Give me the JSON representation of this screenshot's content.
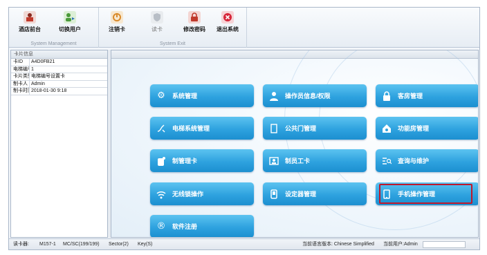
{
  "ribbon": {
    "groups": [
      {
        "caption": "System Management",
        "buttons": [
          {
            "label": "酒店前台",
            "icon": "front-desk-icon",
            "color": "#c0392b"
          },
          {
            "label": "切换用户",
            "icon": "switch-user-icon",
            "color": "#4a9a3a"
          }
        ]
      },
      {
        "caption": "System Exit",
        "buttons": [
          {
            "label": "注销卡",
            "icon": "cancel-card-icon",
            "color": "#d98a2b"
          },
          {
            "label": "读卡",
            "icon": "read-card-icon",
            "color": "#b8bec6",
            "disabled": true
          },
          {
            "label": "修改密码",
            "icon": "lock-icon",
            "color": "#c0392b"
          },
          {
            "label": "退出系统",
            "icon": "exit-icon",
            "color": "#d6263a"
          }
        ]
      }
    ]
  },
  "card_panel": {
    "title": "卡片信息",
    "rows": [
      {
        "key": "卡ID",
        "value": "A4D0FB21"
      },
      {
        "key": "电梯编号",
        "value": "1"
      },
      {
        "key": "卡片类型",
        "value": "电梯编号设置卡"
      },
      {
        "key": "制卡人",
        "value": "Admin"
      },
      {
        "key": "制卡时间",
        "value": "2018-01-30 9:18"
      }
    ]
  },
  "tiles": [
    {
      "label": "系统管理",
      "icon": "gear-icon"
    },
    {
      "label": "操作员信息/权限",
      "icon": "user-icon"
    },
    {
      "label": "客房管理",
      "icon": "lock-icon"
    },
    {
      "label": "电梯系统管理",
      "icon": "elevator-icon"
    },
    {
      "label": "公共门管理",
      "icon": "door-icon"
    },
    {
      "label": "功能房管理",
      "icon": "function-room-icon"
    },
    {
      "label": "制管理卡",
      "icon": "card-icon"
    },
    {
      "label": "制员工卡",
      "icon": "id-card-icon"
    },
    {
      "label": "查询与维护",
      "icon": "search-list-icon"
    },
    {
      "label": "无线锁操作",
      "icon": "wireless-icon"
    },
    {
      "label": "设定器管理",
      "icon": "device-icon"
    },
    {
      "label": "手机操作管理",
      "icon": "mobile-icon",
      "selected": true
    },
    {
      "label": "软件注册",
      "icon": "registered-icon"
    }
  ],
  "status_bar": {
    "reader_label": "读卡器:",
    "reader_model": "M157-1",
    "reader_info": "MC/SC(199/199)",
    "sector": "Sector(2)",
    "key": "Key(S)",
    "language": "当前语言版本: Chinese Simplified",
    "current_user": "当前用户:Admin"
  }
}
